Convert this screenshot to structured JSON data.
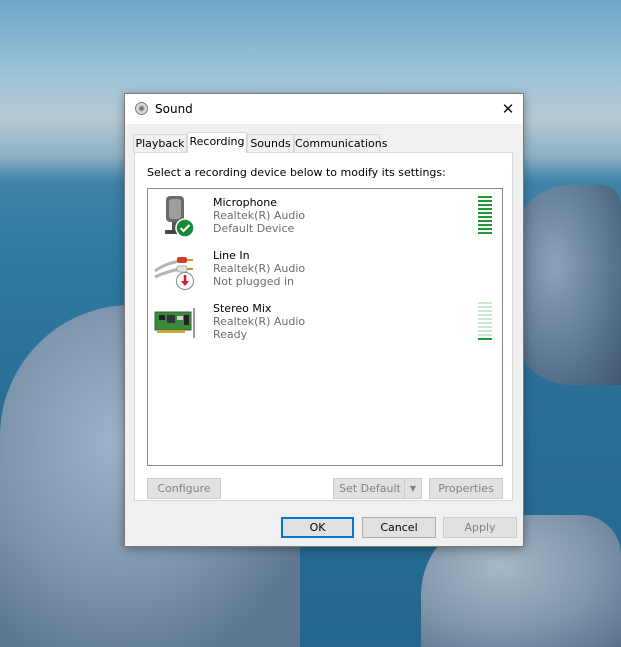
{
  "window": {
    "title": "Sound",
    "close_glyph": "✕"
  },
  "tabs": [
    {
      "label": "Playback"
    },
    {
      "label": "Recording"
    },
    {
      "label": "Sounds"
    },
    {
      "label": "Communications"
    }
  ],
  "instruction": "Select a recording device below to modify its settings:",
  "devices": [
    {
      "name": "Microphone",
      "driver": "Realtek(R) Audio",
      "status": "Default Device",
      "icon": "microphone-icon",
      "badge": "check-badge-icon",
      "level_fraction": 1.0
    },
    {
      "name": "Line In",
      "driver": "Realtek(R) Audio",
      "status": "Not plugged in",
      "icon": "line-in-cable-icon",
      "badge": "unplugged-badge-icon"
    },
    {
      "name": "Stereo Mix",
      "driver": "Realtek(R) Audio",
      "status": "Ready",
      "icon": "sound-card-icon",
      "level_fraction": 0.1
    }
  ],
  "buttons": {
    "configure": "Configure",
    "set_default": "Set Default",
    "properties": "Properties",
    "ok": "OK",
    "cancel": "Cancel",
    "apply": "Apply"
  },
  "colors": {
    "accent": "#0078d7",
    "meter_active": "#1e9b32",
    "meter_inactive": "#c9e8d2",
    "disabled_text": "#838383"
  }
}
